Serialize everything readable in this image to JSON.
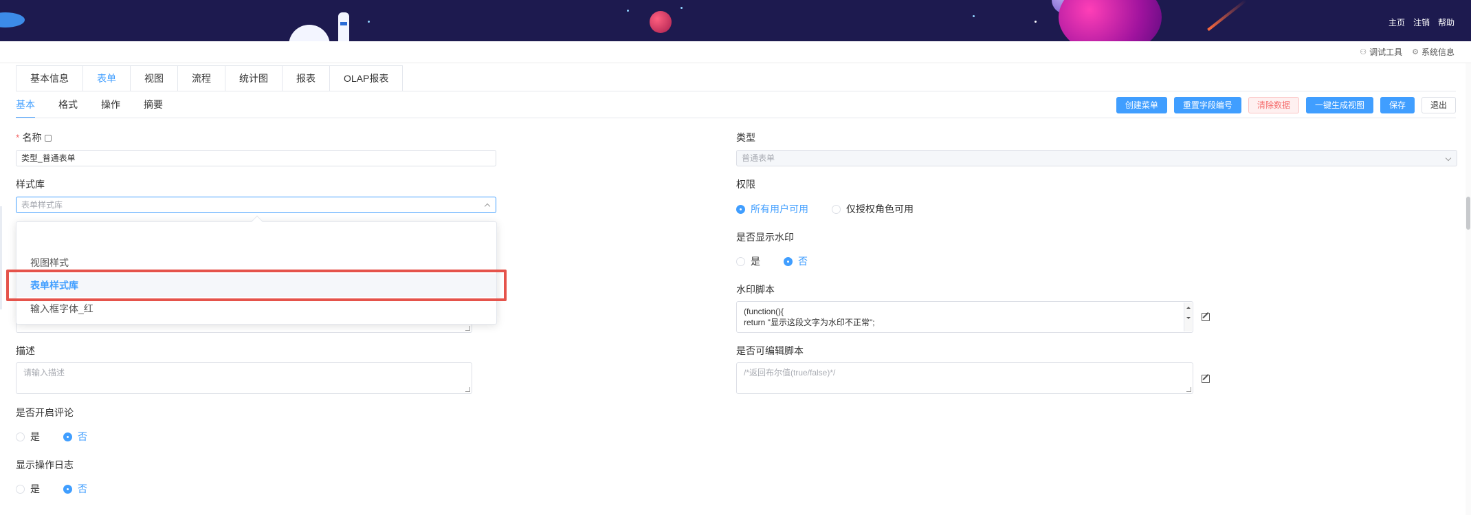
{
  "topnav": {
    "home": "主页",
    "logout": "注销",
    "help": "帮助"
  },
  "subbar": {
    "debug": "调试工具",
    "sysinfo": "系统信息"
  },
  "main_tabs": [
    "基本信息",
    "表单",
    "视图",
    "流程",
    "统计图",
    "报表",
    "OLAP报表"
  ],
  "active_main_tab": "表单",
  "sub_tabs": [
    "基本",
    "格式",
    "操作",
    "摘要"
  ],
  "active_sub_tab": "基本",
  "actions": {
    "create_menu": "创建菜单",
    "reset_field_no": "重置字段编号",
    "clear_data": "清除数据",
    "generate_view": "一键生成视图",
    "save": "保存",
    "exit": "退出"
  },
  "form": {
    "name_label": "名称",
    "name_value": "类型_普通表单",
    "style_lib_label": "样式库",
    "style_lib_placeholder": "表单样式库",
    "desc_label": "描述",
    "desc_placeholder": "请输入描述",
    "comment_label": "是否开启评论",
    "comment_yes": "是",
    "comment_no": "否",
    "oplog_label": "显示操作日志",
    "oplog_yes": "是",
    "oplog_no": "否",
    "type_label": "类型",
    "type_value": "普通表单",
    "perm_label": "权限",
    "perm_all": "所有用户可用",
    "perm_role": "仅授权角色可用",
    "watermark_label": "是否显示水印",
    "watermark_yes": "是",
    "watermark_no": "否",
    "wm_script_label": "水印脚本",
    "wm_script_line1": "(function(){",
    "wm_script_line2": "return \"显示这段文字为水印不正常\";",
    "editable_label": "是否可编辑脚本",
    "editable_placeholder": "/*返回布尔值(true/false)*/"
  },
  "dropdown": {
    "options": [
      "视图样式",
      "表单样式库",
      "输入框字体_红"
    ],
    "selected": "表单样式库"
  },
  "colors": {
    "accent": "#409eff",
    "highlight": "#e5534b",
    "banner": "#1d1a4f"
  }
}
